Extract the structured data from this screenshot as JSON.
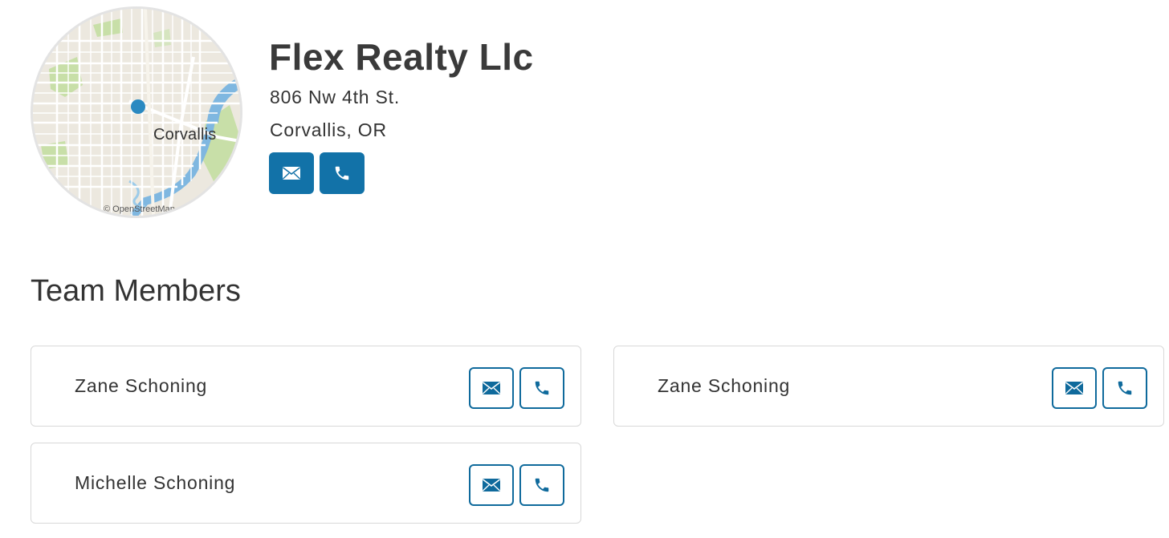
{
  "agency": {
    "name": "Flex Realty Llc",
    "address_line1": "806 Nw 4th St.",
    "address_line2": "Corvallis, OR"
  },
  "map": {
    "city_label": "Corvallis",
    "attribution": "© OpenStreetMap"
  },
  "team": {
    "title": "Team Members",
    "members": [
      {
        "name": "Zane Schoning"
      },
      {
        "name": "Zane Schoning"
      },
      {
        "name": "Michelle Schoning"
      }
    ]
  },
  "colors": {
    "accent": "#1272a8",
    "map_land": "#ece8df",
    "map_park": "#c8dfa8",
    "map_water": "#7fb7e0"
  },
  "icons": {
    "email": "envelope-icon",
    "phone": "phone-icon"
  }
}
